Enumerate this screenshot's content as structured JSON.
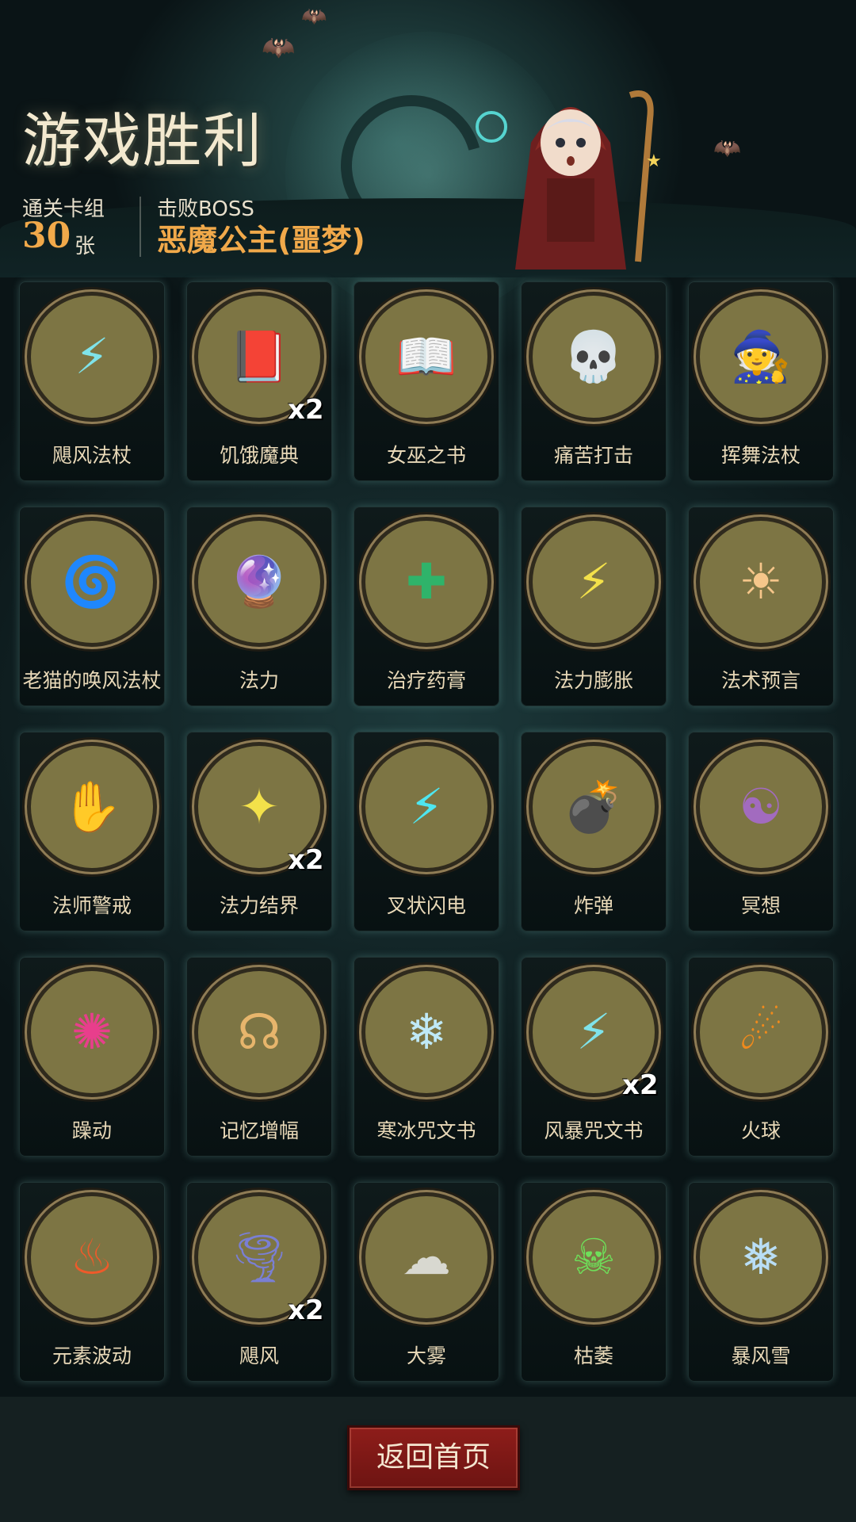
{
  "header": {
    "title": "游戏胜利",
    "deck_label": "通关卡组",
    "deck_count": "30",
    "deck_unit": "张",
    "boss_label": "击败BOSS",
    "boss_name": "恶魔公主(噩梦)"
  },
  "cards": [
    {
      "name": "飓风法杖",
      "icon": "staff-lightning-icon",
      "count": ""
    },
    {
      "name": "饥饿魔典",
      "icon": "hungry-grimoire-icon",
      "count": "x2"
    },
    {
      "name": "女巫之书",
      "icon": "witch-book-icon",
      "count": ""
    },
    {
      "name": "痛苦打击",
      "icon": "pain-strike-icon",
      "count": ""
    },
    {
      "name": "挥舞法杖",
      "icon": "wielding-staff-icon",
      "count": ""
    },
    {
      "name": "老猫的唤风法杖",
      "icon": "cat-wind-staff-icon",
      "count": ""
    },
    {
      "name": "法力",
      "icon": "mana-orb-icon",
      "count": ""
    },
    {
      "name": "治疗药膏",
      "icon": "healing-ointment-icon",
      "count": ""
    },
    {
      "name": "法力膨胀",
      "icon": "mana-surge-icon",
      "count": ""
    },
    {
      "name": "法术预言",
      "icon": "spell-prophecy-icon",
      "count": ""
    },
    {
      "name": "法师警戒",
      "icon": "mage-vigil-icon",
      "count": ""
    },
    {
      "name": "法力结界",
      "icon": "mana-barrier-icon",
      "count": "x2"
    },
    {
      "name": "叉状闪电",
      "icon": "forked-lightning-icon",
      "count": ""
    },
    {
      "name": "炸弹",
      "icon": "bomb-icon",
      "count": ""
    },
    {
      "name": "冥想",
      "icon": "meditation-icon",
      "count": ""
    },
    {
      "name": "躁动",
      "icon": "frenzy-icon",
      "count": ""
    },
    {
      "name": "记忆增幅",
      "icon": "memory-boost-icon",
      "count": ""
    },
    {
      "name": "寒冰咒文书",
      "icon": "ice-spellbook-icon",
      "count": ""
    },
    {
      "name": "风暴咒文书",
      "icon": "storm-spellbook-icon",
      "count": "x2"
    },
    {
      "name": "火球",
      "icon": "fireball-icon",
      "count": ""
    },
    {
      "name": "元素波动",
      "icon": "elemental-wave-icon",
      "count": ""
    },
    {
      "name": "飓风",
      "icon": "tornado-icon",
      "count": "x2"
    },
    {
      "name": "大雾",
      "icon": "fog-icon",
      "count": ""
    },
    {
      "name": "枯萎",
      "icon": "wither-icon",
      "count": ""
    },
    {
      "name": "暴风雪",
      "icon": "blizzard-icon",
      "count": ""
    }
  ],
  "footer": {
    "home_button_label": "返回首页"
  }
}
